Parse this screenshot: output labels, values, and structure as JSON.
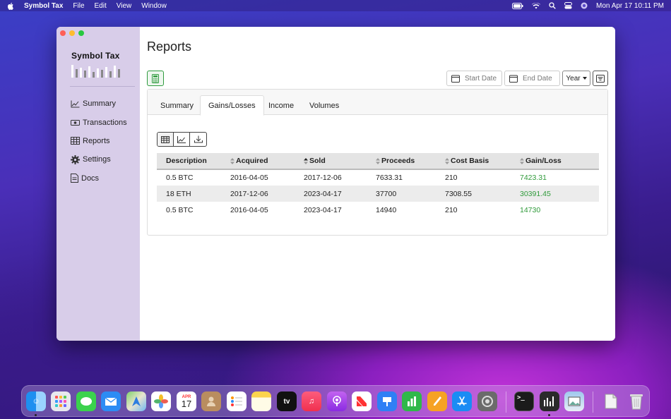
{
  "menubar": {
    "app_name": "Symbol Tax",
    "menus": [
      "File",
      "Edit",
      "View",
      "Window"
    ],
    "clock": "Mon Apr 17  10:11 PM"
  },
  "sidebar": {
    "logo_text": "Symbol Tax",
    "items": [
      {
        "label": "Summary",
        "icon": "chart-line-icon"
      },
      {
        "label": "Transactions",
        "icon": "cash-icon"
      },
      {
        "label": "Reports",
        "icon": "table-icon"
      },
      {
        "label": "Settings",
        "icon": "gear-icon"
      },
      {
        "label": "Docs",
        "icon": "document-icon"
      }
    ]
  },
  "main": {
    "title": "Reports",
    "start_date_placeholder": "Start Date",
    "end_date_placeholder": "End Date",
    "year_label": "Year",
    "tabs": [
      "Summary",
      "Gains/Losses",
      "Income",
      "Volumes"
    ],
    "active_tab": "Gains/Losses",
    "table": {
      "headers": [
        "Description",
        "Acquired",
        "Sold",
        "Proceeds",
        "Cost Basis",
        "Gain/Loss"
      ],
      "rows": [
        [
          "0.5 BTC",
          "2016-04-05",
          "2017-12-06",
          "7633.31",
          "210",
          "7423.31"
        ],
        [
          "18 ETH",
          "2017-12-06",
          "2023-04-17",
          "37700",
          "7308.55",
          "30391.45"
        ],
        [
          "0.5 BTC",
          "2016-04-05",
          "2023-04-17",
          "14940",
          "210",
          "14730"
        ]
      ]
    }
  },
  "dock": {
    "calendar_month": "APR",
    "calendar_day": "17",
    "apps": [
      "finder",
      "launchpad",
      "messages",
      "mail",
      "maps",
      "photos",
      "calendar",
      "contacts",
      "reminders",
      "notes",
      "tv",
      "music",
      "podcasts",
      "news",
      "keynote",
      "numbers",
      "pages",
      "app-store",
      "system-preferences",
      "terminal",
      "symbol-tax",
      "preview",
      "file",
      "trash"
    ]
  },
  "colors": {
    "gain": "#2f9a3a",
    "sidebar": "#d8cde9",
    "accent_green": "#2e9b3d"
  }
}
